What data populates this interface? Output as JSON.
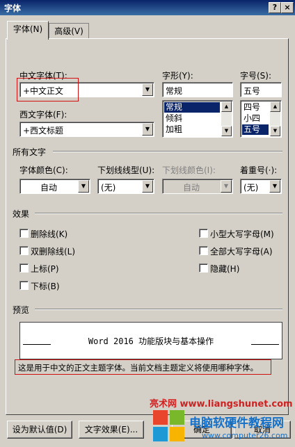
{
  "window": {
    "title": "字体",
    "help_btn": "?",
    "close_btn": "×"
  },
  "tabs": [
    {
      "label": "字体(N)"
    },
    {
      "label": "高级(V)"
    }
  ],
  "font": {
    "cn_label": "中文字体(T):",
    "cn_value": "+中文正文",
    "style_label": "字形(Y):",
    "style_value": "常规",
    "style_list": [
      "常规",
      "倾斜",
      "加粗"
    ],
    "size_label": "字号(S):",
    "size_value": "五号",
    "size_list": [
      "四号",
      "小四",
      "五号"
    ],
    "west_label": "西文字体(F):",
    "west_value": "+西文标题"
  },
  "all_text": {
    "section": "所有文字",
    "color_label": "字体颜色(C):",
    "color_value": "自动",
    "underline_label": "下划线线型(U):",
    "underline_value": "(无)",
    "ucolor_label": "下划线颜色(I):",
    "ucolor_value": "自动",
    "emphasis_label": "着重号(·):",
    "emphasis_value": "(无)"
  },
  "effects": {
    "section": "效果",
    "left": [
      "删除线(K)",
      "双删除线(L)",
      "上标(P)",
      "下标(B)"
    ],
    "right": [
      "小型大写字母(M)",
      "全部大写字母(A)",
      "隐藏(H)"
    ]
  },
  "preview": {
    "section": "预览",
    "text": "Word 2016 功能版块与基本操作",
    "note": "这是用于中文的正文主题字体。当前文档主题定义将使用哪种字体。"
  },
  "buttons": {
    "default": "设为默认值(D)",
    "effects": "文字效果(E)...",
    "ok": "确定",
    "cancel": "取消"
  },
  "watermark": {
    "line1": "亮术网 www.liangshunet.com",
    "line2": "电脑软硬件教程网",
    "line3": "www.computer26.com"
  }
}
